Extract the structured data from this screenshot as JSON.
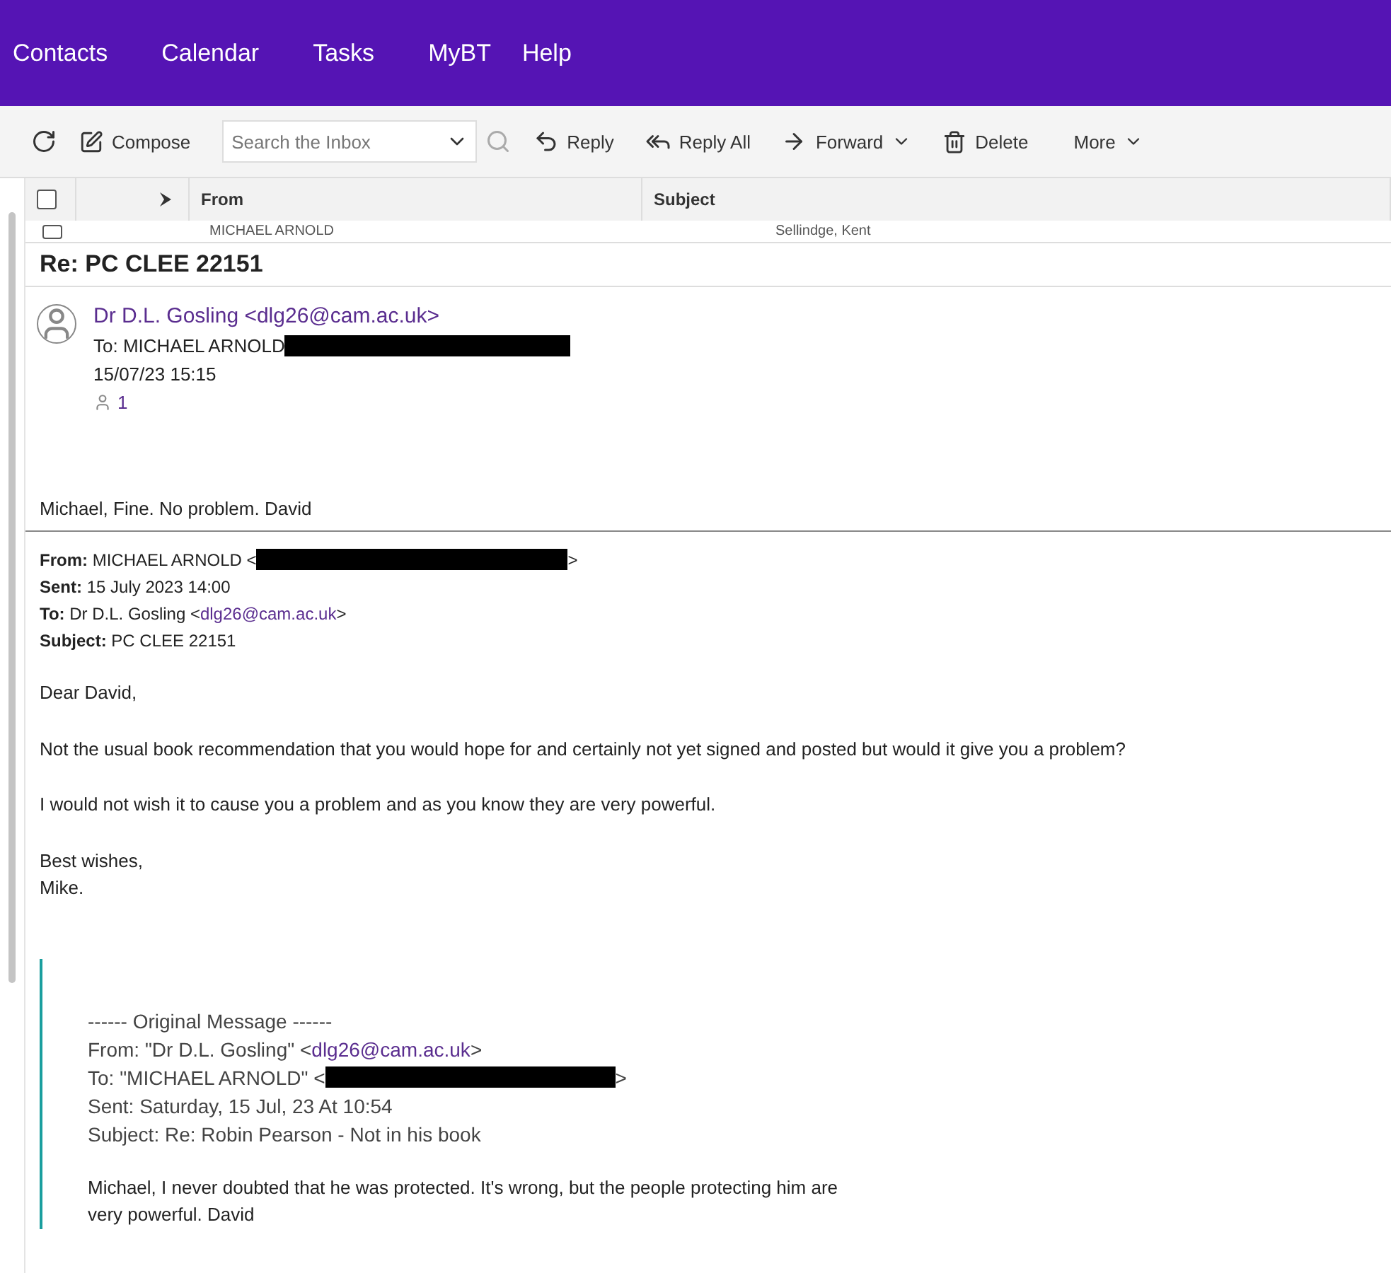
{
  "nav": [
    "Contacts",
    "Calendar",
    "Tasks",
    "MyBT",
    "Help"
  ],
  "toolbar": {
    "compose": "Compose",
    "search": {
      "placeholder": "Search the Inbox"
    },
    "reply": "Reply",
    "reply_all": "Reply All",
    "forward": "Forward",
    "delete": "Delete",
    "more": "More"
  },
  "list": {
    "all_checked": false,
    "columns": [
      "From",
      "Subject"
    ],
    "rows": [
      {
        "checked": false,
        "from": "MICHAEL ARNOLD",
        "subject": "Sellindge, Kent"
      }
    ]
  },
  "message": {
    "subject": "Re: PC CLEE 22151",
    "sender": "Dr D.L. Gosling <dlg26@cam.ac.uk>",
    "to": "To: MICHAEL ARNOLD",
    "to_redacted": true,
    "date": "15/07/23 15:15",
    "recipients": "1",
    "reply": "Michael, Fine. No problem.  David",
    "header": [
      {
        "text": "**From:** MICHAEL ARNOLD <",
        "redacted": true,
        "tail": ">"
      },
      {
        "text": "**Sent:** 15 July 2023 14:00"
      },
      {
        "text": "**To:** Dr D.L. Gosling <",
        "link": "dlg26@cam.ac.uk",
        "tail": ">"
      },
      {
        "text": "**Subject:** PC CLEE 22151"
      }
    ],
    "paragraphs": [
      "Dear David,",
      "Not the usual book recommendation that you would hope for and certainly not yet signed and posted but would it give you a problem?",
      "I would not wish it to cause you a problem and as you know they are very powerful.",
      "Best wishes,\nMike."
    ],
    "quote": {
      "lines": [
        {
          "text": "------ Original Message ------"
        },
        {
          "text": "From: \"Dr D.L. Gosling\" <",
          "link": "dlg26@cam.ac.uk",
          "tail": ">"
        },
        {
          "text": "To: \"MICHAEL ARNOLD\" <",
          "redacted": true,
          "tail": ">"
        },
        {
          "text": "Sent: Saturday, 15 Jul, 23 At 10:54"
        },
        {
          "text": "Subject: Re: Robin Pearson - Not in his book"
        }
      ],
      "body": "Michael, I never doubted that he was protected. It's wrong, but the people protecting him are\nvery powerful. David"
    }
  }
}
